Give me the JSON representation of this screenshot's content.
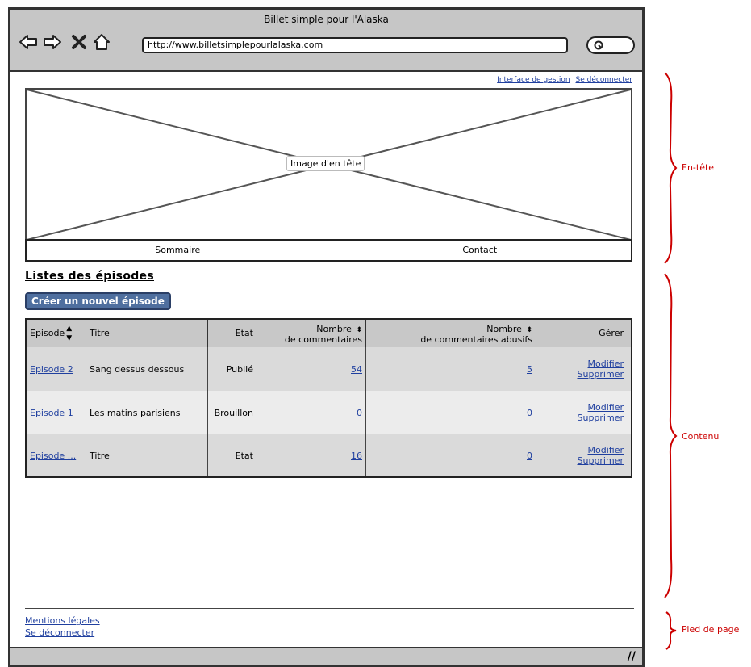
{
  "browser": {
    "title": "Billet simple pour l'Alaska",
    "url": "http://www.billetsimplepourlalaska.com"
  },
  "header": {
    "links": [
      "Interface de gestion",
      "Se déconnecter"
    ],
    "image_label": "Image d'en tête",
    "nav": [
      "Sommaire",
      "Contact"
    ]
  },
  "main": {
    "title": "Listes des épisodes",
    "create_button": "Créer un nouvel épisode",
    "table": {
      "headers": {
        "episode": "Episode",
        "title": "Titre",
        "state": "Etat",
        "comments_1": "Nombre",
        "comments_2": "de commentaires",
        "abusive_1": "Nombre",
        "abusive_2": "de commentaires abusifs",
        "manage": "Gérer"
      },
      "rows": [
        {
          "episode": "Episode 2",
          "title": "Sang dessus dessous",
          "state": "Publié",
          "comments": "54",
          "abusive": "5",
          "edit": "Modifier",
          "delete": "Supprimer"
        },
        {
          "episode": "Episode 1",
          "title": "Les matins parisiens",
          "state": "Brouillon",
          "comments": "0",
          "abusive": "0",
          "edit": "Modifier",
          "delete": "Supprimer"
        },
        {
          "episode": "Episode ...",
          "title": "Titre",
          "state": "Etat",
          "comments": "16",
          "abusive": "0",
          "edit": "Modifier",
          "delete": "Supprimer"
        }
      ]
    }
  },
  "footer": {
    "links": [
      "Mentions légales",
      "Se déconnecter"
    ]
  },
  "annotations": [
    "En-tête",
    "Contenu",
    "Pied de page"
  ],
  "colors": {
    "annotation": "#cc0000",
    "link": "#1f3f9f",
    "button": "#4f6f9f"
  }
}
